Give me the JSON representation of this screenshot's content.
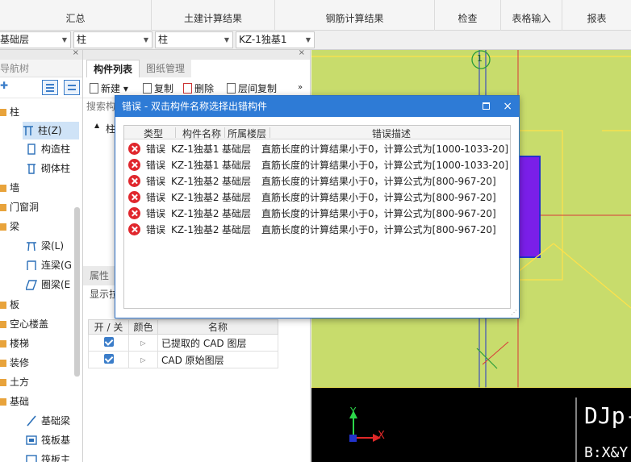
{
  "ribbon": {
    "groups": [
      "汇总",
      "土建计算结果",
      "钢筋计算结果",
      "检查",
      "表格输入",
      "报表"
    ]
  },
  "selectors": {
    "floor": "基础层",
    "category": "柱",
    "type": "柱",
    "component": "KZ-1独基1"
  },
  "nav": {
    "title": "导航树",
    "close": "×",
    "items": {
      "col_group": "柱",
      "col": "柱(Z)",
      "gz": "构造柱",
      "qtz": "砌体柱",
      "wall": "墙",
      "door": "门窗洞",
      "beam_group": "梁",
      "beam": "梁(L)",
      "lianl": "连梁(G",
      "quanl": "圈梁(E",
      "slab": "板",
      "hollow": "空心楼盖",
      "stair": "楼梯",
      "deco": "装修",
      "earth": "土方",
      "found": "基础",
      "fbeam": "基础梁",
      "raft": "筏板基",
      "raft2": "筏板主"
    }
  },
  "components": {
    "tab_list": "构件列表",
    "tab_drawing": "图纸管理",
    "close": "×",
    "tools": {
      "new": "新建",
      "copy": "复制",
      "delete": "删除",
      "floorcopy": "层间复制",
      "more": "»"
    },
    "search": "搜索构",
    "tree_root": "柱",
    "tree_expand": "▲",
    "props_title": "属性",
    "show": "显示拉",
    "layer_headers": {
      "onoff": "开 / 关",
      "color": "颜色",
      "name": "名称"
    },
    "layers": [
      {
        "name": "已提取的 CAD 图层"
      },
      {
        "name": "CAD 原始图层"
      }
    ]
  },
  "canvas": {
    "axis_label": "1",
    "cad_text_1": "DJp-",
    "cad_text_2": "B:X&Y",
    "axis_x": "X",
    "axis_y": "Y"
  },
  "dialog": {
    "title": "错误 - 双击构件名称选择出错构件",
    "close": "×",
    "headers": {
      "type": "类型",
      "name": "构件名称",
      "floor": "所属楼层",
      "desc": "错误描述"
    },
    "rows": [
      {
        "type": "错误",
        "name": "KZ-1独基1",
        "floor": "基础层",
        "desc": "直筋长度的计算结果小于0，计算公式为[1000-1033-20]"
      },
      {
        "type": "错误",
        "name": "KZ-1独基1",
        "floor": "基础层",
        "desc": "直筋长度的计算结果小于0，计算公式为[1000-1033-20]"
      },
      {
        "type": "错误",
        "name": "KZ-1独基2",
        "floor": "基础层",
        "desc": "直筋长度的计算结果小于0，计算公式为[800-967-20]"
      },
      {
        "type": "错误",
        "name": "KZ-1独基2",
        "floor": "基础层",
        "desc": "直筋长度的计算结果小于0，计算公式为[800-967-20]"
      },
      {
        "type": "错误",
        "name": "KZ-1独基2",
        "floor": "基础层",
        "desc": "直筋长度的计算结果小于0，计算公式为[800-967-20]"
      },
      {
        "type": "错误",
        "name": "KZ-1独基2",
        "floor": "基础层",
        "desc": "直筋长度的计算结果小于0，计算公式为[800-967-20]"
      }
    ]
  },
  "colors": {
    "accent": "#2e7bd6",
    "error": "#e0272d",
    "canvas": "#c8dc6c",
    "component_fill": "#7a1fe8"
  }
}
